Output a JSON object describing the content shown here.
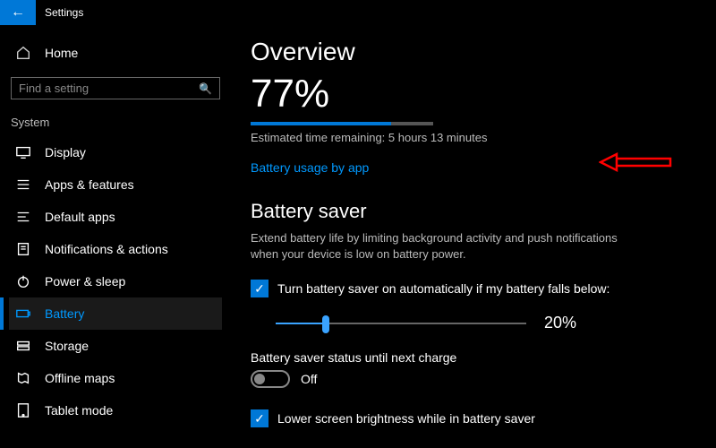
{
  "header": {
    "title": "Settings"
  },
  "sidebar": {
    "home_label": "Home",
    "search_placeholder": "Find a setting",
    "section_label": "System",
    "items": [
      {
        "label": "Display"
      },
      {
        "label": "Apps & features"
      },
      {
        "label": "Default apps"
      },
      {
        "label": "Notifications & actions"
      },
      {
        "label": "Power & sleep"
      },
      {
        "label": "Battery"
      },
      {
        "label": "Storage"
      },
      {
        "label": "Offline maps"
      },
      {
        "label": "Tablet mode"
      }
    ],
    "selected_index": 5
  },
  "overview": {
    "heading": "Overview",
    "percent_text": "77%",
    "percent_value": 77,
    "eta": "Estimated time remaining: 5 hours 13 minutes",
    "usage_link": "Battery usage by app"
  },
  "battery_saver": {
    "heading": "Battery saver",
    "description": "Extend battery life by limiting background activity and push notifications when your device is low on battery power.",
    "auto_checkbox_label": "Turn battery saver on automatically if my battery falls below:",
    "auto_checkbox_checked": true,
    "threshold_percent": 20,
    "threshold_text": "20%",
    "status_label": "Battery saver status until next charge",
    "toggle_on": false,
    "toggle_state_text": "Off",
    "brightness_checkbox_label": "Lower screen brightness while in battery saver",
    "brightness_checkbox_checked": true
  },
  "colors": {
    "accent": "#0078d7",
    "link": "#0099ff"
  }
}
